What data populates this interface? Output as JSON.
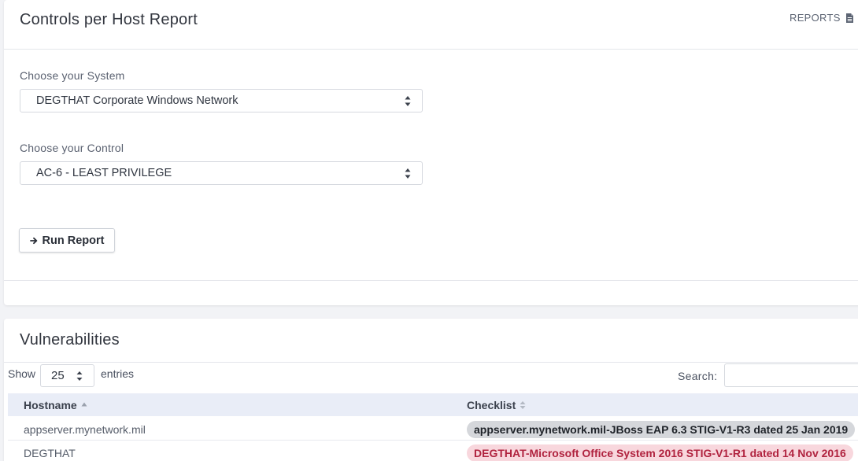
{
  "report_card": {
    "title": "Controls per Host Report",
    "reports_link": "REPORTS",
    "system_label": "Choose your System",
    "system_value": "DEGTHAT Corporate Windows Network",
    "control_label": "Choose your Control",
    "control_value": "AC-6 - LEAST PRIVILEGE",
    "run_button": "Run Report"
  },
  "vulns_card": {
    "title": "Vulnerabilities",
    "show_prefix": "Show",
    "page_length": "25",
    "show_suffix": "entries",
    "search_label": "Search:",
    "search_value": "",
    "columns": [
      "Hostname",
      "Checklist"
    ],
    "rows": [
      {
        "hostname": "appserver.mynetwork.mil",
        "checklist": "appserver.mynetwork.mil-JBoss EAP 6.3 STIG-V1-R3 dated 25 Jan 2019",
        "badge_style": "gray"
      },
      {
        "hostname": "DEGTHAT",
        "checklist": "DEGTHAT-Microsoft Office System 2016 STIG-V1-R1 dated 14 Nov 2016",
        "badge_style": "red"
      }
    ]
  },
  "colors": {
    "page_bg": "#f2f3f6",
    "header_row_bg": "#e9edf7",
    "badge_gray_bg": "#d5d7db",
    "badge_gray_text": "#1f2329",
    "badge_red_bg": "#f8d7dd",
    "badge_red_text": "#b0233f"
  },
  "icons": {
    "reports": "document-icon",
    "run": "arrow-right-icon",
    "select": "sort-arrows-icon",
    "sort_asc": "sort-up-icon",
    "sort_both": "sort-both-icon"
  }
}
